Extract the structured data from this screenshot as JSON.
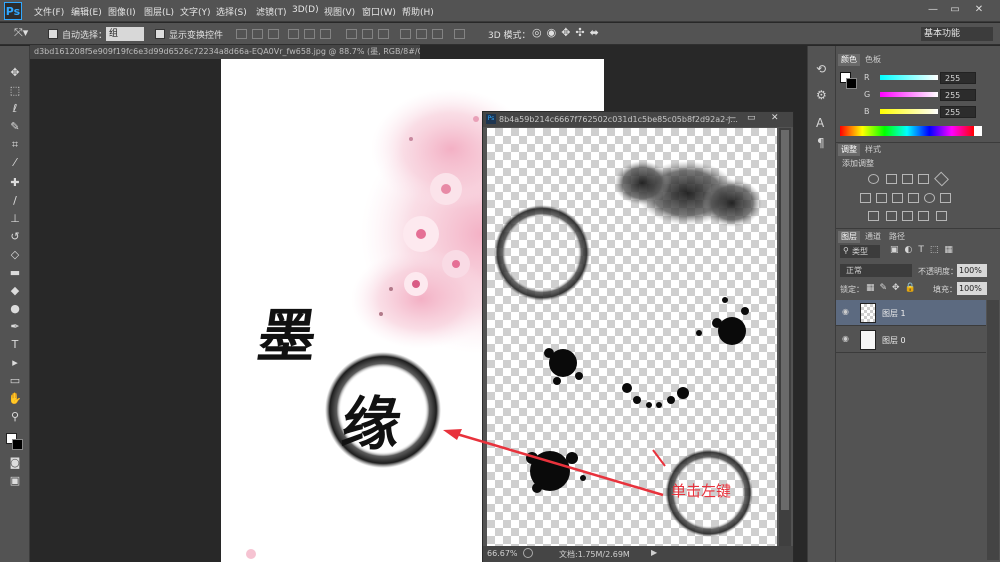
{
  "app": {
    "logo": "Ps"
  },
  "menu": [
    "文件(F)",
    "编辑(E)",
    "图像(I)",
    "图层(L)",
    "文字(Y)",
    "选择(S)",
    "滤镜(T)",
    "3D(D)",
    "视图(V)",
    "窗口(W)",
    "帮助(H)"
  ],
  "window_controls": {
    "minimize": "—",
    "restore": "▭",
    "close": "✕"
  },
  "options": {
    "auto_select_label": "自动选择：",
    "auto_select_value": "组",
    "show_transform_label": "显示变换控件",
    "mode_3d_label": "3D 模式：",
    "workspace": "基本功能"
  },
  "document": {
    "tab_title": "d3bd161208f5e909f19fc6e3d99d6526c72234a8d66a-EQA0Vr_fw658.jpg @ 88.7% (墨, RGB/8#/CMYK) *",
    "calligraphy_1": "墨",
    "calligraphy_2": "缘"
  },
  "floating": {
    "title": "8b4a59b214c6667f762502c031d1c5be85c05b8f2d92a2-j...",
    "zoom": "66.67%",
    "doc_info": "文档:1.75M/2.69M",
    "annotation": "单击左键"
  },
  "panels": {
    "tabs_color": [
      "颜色",
      "色板"
    ],
    "rgb": [
      {
        "label": "R",
        "value": "255",
        "gradient": "linear-gradient(to right,#00ffff,#ffffff)"
      },
      {
        "label": "G",
        "value": "255",
        "gradient": "linear-gradient(to right,#ff00ff,#ffffff)"
      },
      {
        "label": "B",
        "value": "255",
        "gradient": "linear-gradient(to right,#ffff00,#ffffff)"
      }
    ],
    "tabs_adjust": [
      "调整",
      "样式"
    ],
    "add_adjustment": "添加调整",
    "tabs_layers": [
      "图层",
      "通道",
      "路径"
    ],
    "kind_filter": "类型",
    "blend_mode": "正常",
    "opacity_label": "不透明度：",
    "opacity_value": "100%",
    "lock_label": "锁定：",
    "fill_label": "填充：",
    "fill_value": "100%",
    "layers": [
      {
        "name": "图层 1",
        "selected": true
      },
      {
        "name": "图层 0",
        "selected": false
      }
    ]
  },
  "colors": {
    "annotation_red": "#e8323c",
    "panel_bg": "#535353",
    "selected_layer": "#5c6a80"
  },
  "icons": [
    "move-tool-icon",
    "marquee-icon",
    "lasso-icon",
    "quick-select-icon",
    "crop-icon",
    "eyedropper-icon",
    "healing-icon",
    "brush-icon",
    "stamp-icon",
    "history-brush-icon",
    "eraser-icon",
    "gradient-icon",
    "blur-icon",
    "dodge-icon",
    "pen-icon",
    "type-icon",
    "path-select-icon",
    "shape-icon",
    "hand-icon",
    "zoom-icon"
  ]
}
